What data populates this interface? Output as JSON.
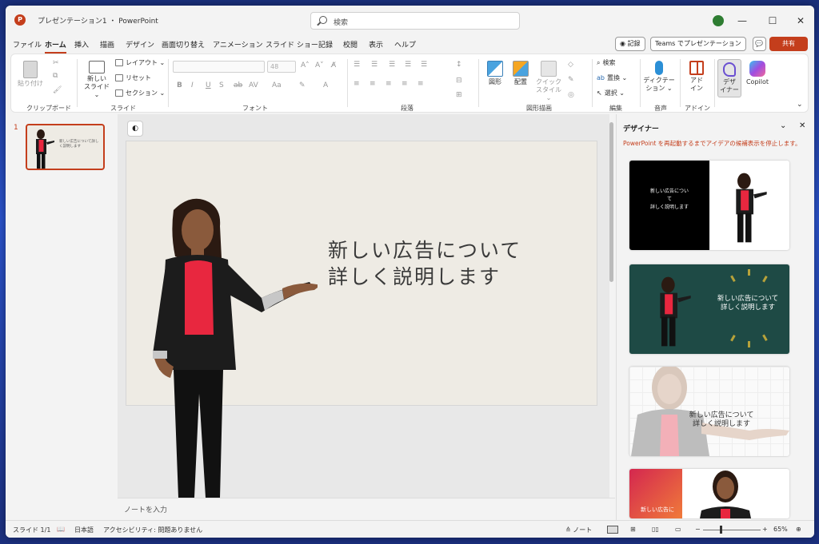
{
  "app": {
    "title": "プレゼンテーション1 ・ PowerPoint",
    "logo": "P"
  },
  "search": {
    "placeholder": "検索"
  },
  "window_controls": {
    "minimize": "—",
    "maximize": "☐",
    "close": "✕"
  },
  "tabs": [
    "ファイル",
    "ホーム",
    "挿入",
    "描画",
    "デザイン",
    "画面切り替え",
    "アニメーション",
    "スライド ショー",
    "記録",
    "校閲",
    "表示",
    "ヘルプ"
  ],
  "active_tab": "ホーム",
  "header_buttons": {
    "record": "◉ 記録",
    "teams": "Teams でプレゼンテーション",
    "comment": "💬",
    "share": "共有"
  },
  "ribbon": {
    "clipboard": {
      "label": "クリップボード",
      "paste": "貼り付け"
    },
    "slides": {
      "label": "スライド",
      "new_slide": "新しい",
      "new_slide2": "スライド ⌄",
      "layout": "レイアウト ⌄",
      "reset": "リセット",
      "section": "セクション ⌄"
    },
    "font": {
      "label": "フォント",
      "size": "48"
    },
    "paragraph": {
      "label": "段落"
    },
    "drawing": {
      "label": "図形描画",
      "shapes": "図形",
      "arrange": "配置",
      "quick_styles1": "クイック",
      "quick_styles2": "スタイル ⌄"
    },
    "editing": {
      "label": "編集",
      "find": "検索",
      "replace": "置換 ⌄",
      "select": "選択 ⌄"
    },
    "voice": {
      "label": "音声",
      "dictate1": "ディクテー",
      "dictate2": "ション ⌄"
    },
    "addins": {
      "label": "アドイン",
      "addins1": "アド",
      "addins2": "イン"
    },
    "designer": {
      "label1": "デザ",
      "label2": "イナー"
    },
    "copilot": {
      "label": "Copilot"
    }
  },
  "thumbnail": {
    "number": "1",
    "text": "新しい広告について詳しく説明します"
  },
  "slide": {
    "title_line1": "新しい広告について",
    "title_line2": "詳しく説明します"
  },
  "notes": {
    "placeholder": "ノートを入力"
  },
  "designer_pane": {
    "title": "デザイナー",
    "message": "PowerPoint を再起動するまでアイデアの候補表示を停止します。",
    "ideas": [
      {
        "line1": "新しい広告につい",
        "line2": "て",
        "line3": "詳しく説明します"
      },
      {
        "line1": "新しい広告について",
        "line2": "詳しく説明します"
      },
      {
        "line1": "新しい広告について",
        "line2": "詳しく説明します"
      },
      {
        "line1": "新しい広告に"
      }
    ]
  },
  "status": {
    "slide": "スライド 1/1",
    "language": "日本語",
    "accessibility": "アクセシビリティ: 問題ありません",
    "notes": "≙ ノート",
    "zoom": "65%"
  },
  "colors": {
    "accent": "#c43e1c",
    "slide_bg": "#eeebe4",
    "teal": "#1e4a45",
    "blouse": "#e8273f"
  }
}
